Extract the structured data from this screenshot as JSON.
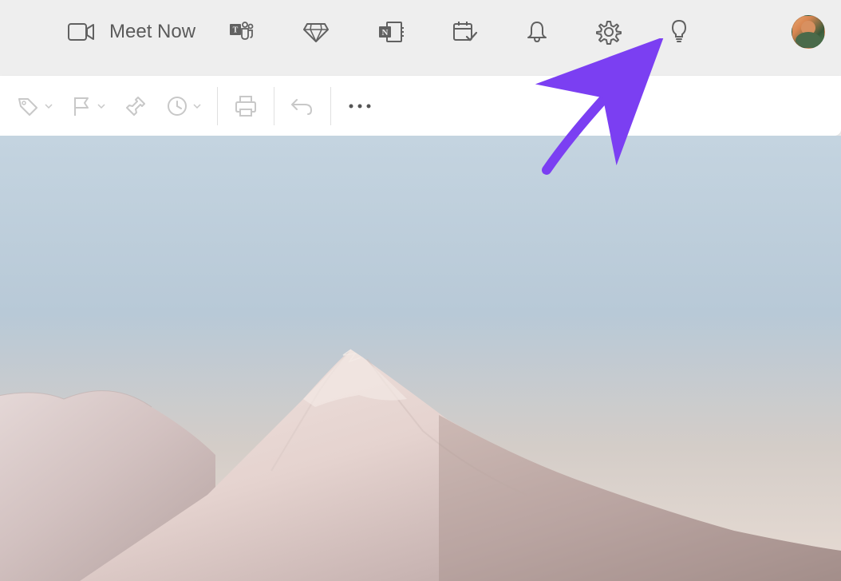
{
  "header": {
    "meet_now_label": "Meet Now",
    "icons": {
      "video": "video-icon",
      "teams": "teams-icon",
      "premium": "diamond-icon",
      "onenote": "onenote-icon",
      "calendar": "calendar-icon",
      "notifications": "bell-icon",
      "settings": "gear-icon",
      "tips": "lightbulb-icon"
    }
  },
  "toolbar": {
    "items": {
      "tag": "tag-icon",
      "flag": "flag-icon",
      "pin": "pin-icon",
      "snooze": "clock-icon",
      "print": "print-icon",
      "undo": "undo-icon",
      "more": "more-icon"
    }
  },
  "annotation": {
    "arrow_color": "#7b3ff2"
  }
}
